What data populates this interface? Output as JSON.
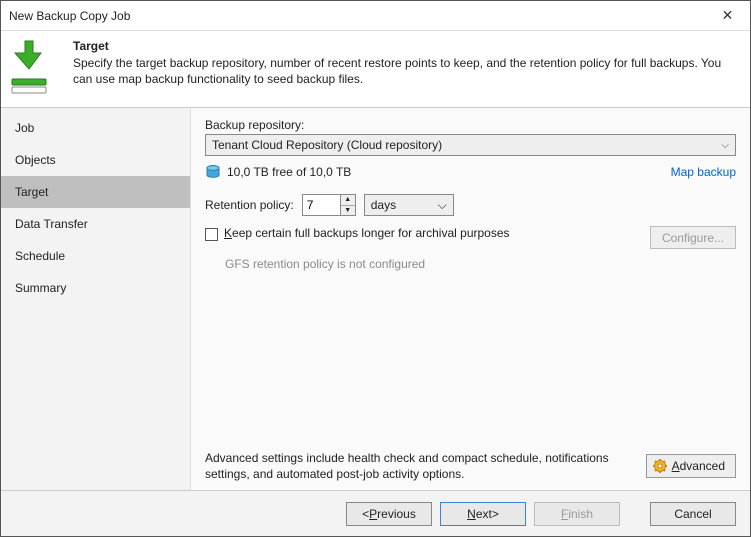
{
  "window": {
    "title": "New Backup Copy Job"
  },
  "header": {
    "title": "Target",
    "description": "Specify the target backup repository, number of recent restore points to keep, and the retention policy for full backups. You can use map backup functionality to seed backup files."
  },
  "sidebar": {
    "items": [
      {
        "label": "Job"
      },
      {
        "label": "Objects"
      },
      {
        "label": "Target"
      },
      {
        "label": "Data Transfer"
      },
      {
        "label": "Schedule"
      },
      {
        "label": "Summary"
      }
    ],
    "active_index": 2
  },
  "main": {
    "repo_label": "Backup repository:",
    "repo_value": "Tenant Cloud Repository (Cloud repository)",
    "freespace": "10,0 TB free of 10,0 TB",
    "map_link": "Map backup",
    "retention_label": "Retention policy:",
    "retention_value": "7",
    "retention_unit": "days",
    "keep_checkbox_pre": "K",
    "keep_checkbox_rest": "eep certain full backups longer for archival purposes",
    "configure_btn": "Configure...",
    "gfs_note": "GFS retention policy is not configured",
    "advanced_note": "Advanced settings include health check and compact schedule, notifications settings, and automated post-job activity options.",
    "advanced_btn_pre": "A",
    "advanced_btn_rest": "dvanced"
  },
  "footer": {
    "previous_pre": "P",
    "previous_rest": "revious",
    "next_pre": "N",
    "next_rest": "ext",
    "finish_pre": "F",
    "finish_rest": "inish",
    "cancel": "Cancel"
  }
}
